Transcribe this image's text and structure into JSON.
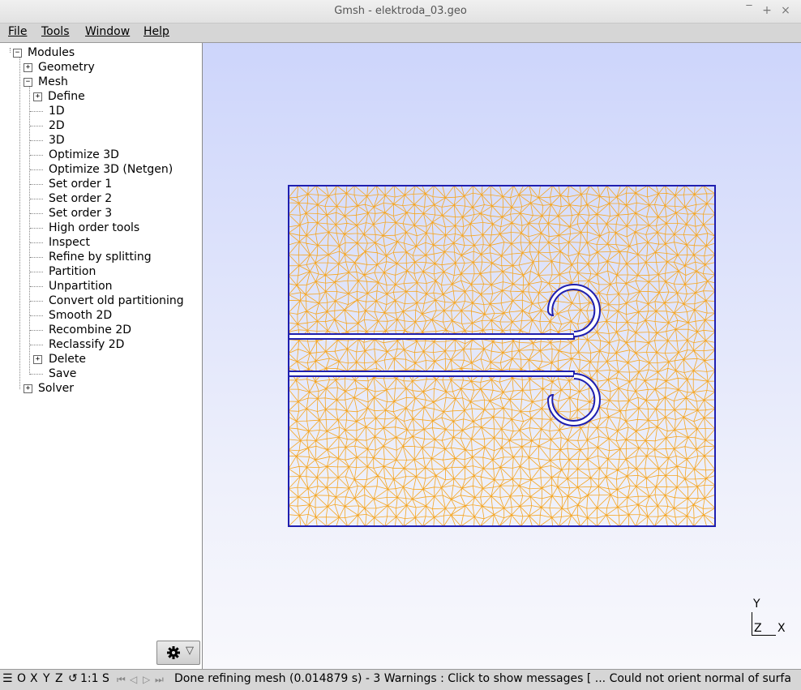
{
  "window": {
    "title": "Gmsh - elektroda_03.geo",
    "minimize_glyph": "×",
    "maximize_glyph": "+",
    "close_glyph": "×"
  },
  "menu": {
    "items": [
      "File",
      "Tools",
      "Window",
      "Help"
    ]
  },
  "tree": {
    "modules": "Modules",
    "geometry": "Geometry",
    "mesh": "Mesh",
    "mesh_children": [
      "Define",
      "1D",
      "2D",
      "3D",
      "Optimize 3D",
      "Optimize 3D (Netgen)",
      "Set order 1",
      "Set order 2",
      "Set order 3",
      "High order tools",
      "Inspect",
      "Refine by splitting",
      "Partition",
      "Unpartition",
      "Convert old partitioning",
      "Smooth 2D",
      "Recombine 2D",
      "Reclassify 2D",
      "Delete",
      "Save"
    ],
    "solver": "Solver",
    "expand_glyph": "+",
    "collapse_glyph": "−"
  },
  "gear_button": {
    "icon": "gear-icon",
    "arrow": "▽"
  },
  "axes": {
    "y": "Y",
    "z": "Z",
    "x": "X"
  },
  "status": {
    "menu_icon": "☰",
    "o": "O",
    "x": "X",
    "y": "Y",
    "z": "Z",
    "rotate_icon": "↺",
    "scale": "1:1",
    "s": "S",
    "nav_icons": [
      "⏮",
      "◁",
      "▷",
      "⏭"
    ],
    "message": "Done refining mesh (0.014879 s)  -  3 Warnings : Click to show messages [ ... Could not orient normal of surfa"
  },
  "colors": {
    "mesh": "#f5a623",
    "boundary": "#1f1fb0",
    "viewport_top": "#cdd5fb",
    "viewport_bottom": "#f8f8fc"
  }
}
